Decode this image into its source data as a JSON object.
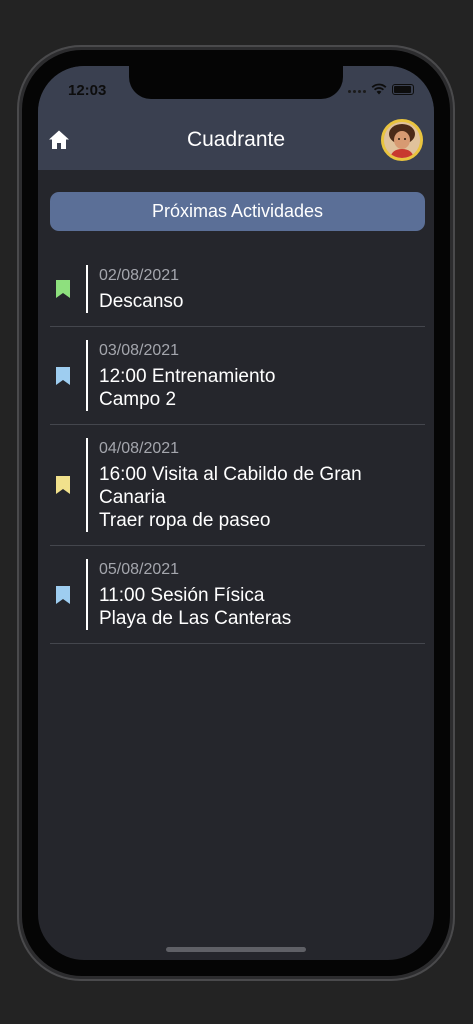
{
  "status_bar": {
    "time": "12:03"
  },
  "app_bar": {
    "title": "Cuadrante",
    "home_icon": "home-icon",
    "avatar": "avatar"
  },
  "section_button": {
    "label": "Próximas Actividades"
  },
  "activities": [
    {
      "date": "02/08/2021",
      "text": "Descanso",
      "bookmark_color": "#8ee07e"
    },
    {
      "date": "03/08/2021",
      "text": "12:00 Entrenamiento\nCampo 2",
      "bookmark_color": "#9ecdf0"
    },
    {
      "date": "04/08/2021",
      "text": "16:00 Visita al Cabildo de Gran\nCanaria\nTraer ropa de paseo",
      "bookmark_color": "#f1e18c"
    },
    {
      "date": "05/08/2021",
      "text": "11:00 Sesión Física\nPlaya de Las Canteras",
      "bookmark_color": "#9ecdf0"
    }
  ],
  "colors": {
    "app_bar": "#3a4050",
    "background": "#25262c",
    "section_button": "#5b6f97",
    "avatar_border": "#e9c43f"
  }
}
